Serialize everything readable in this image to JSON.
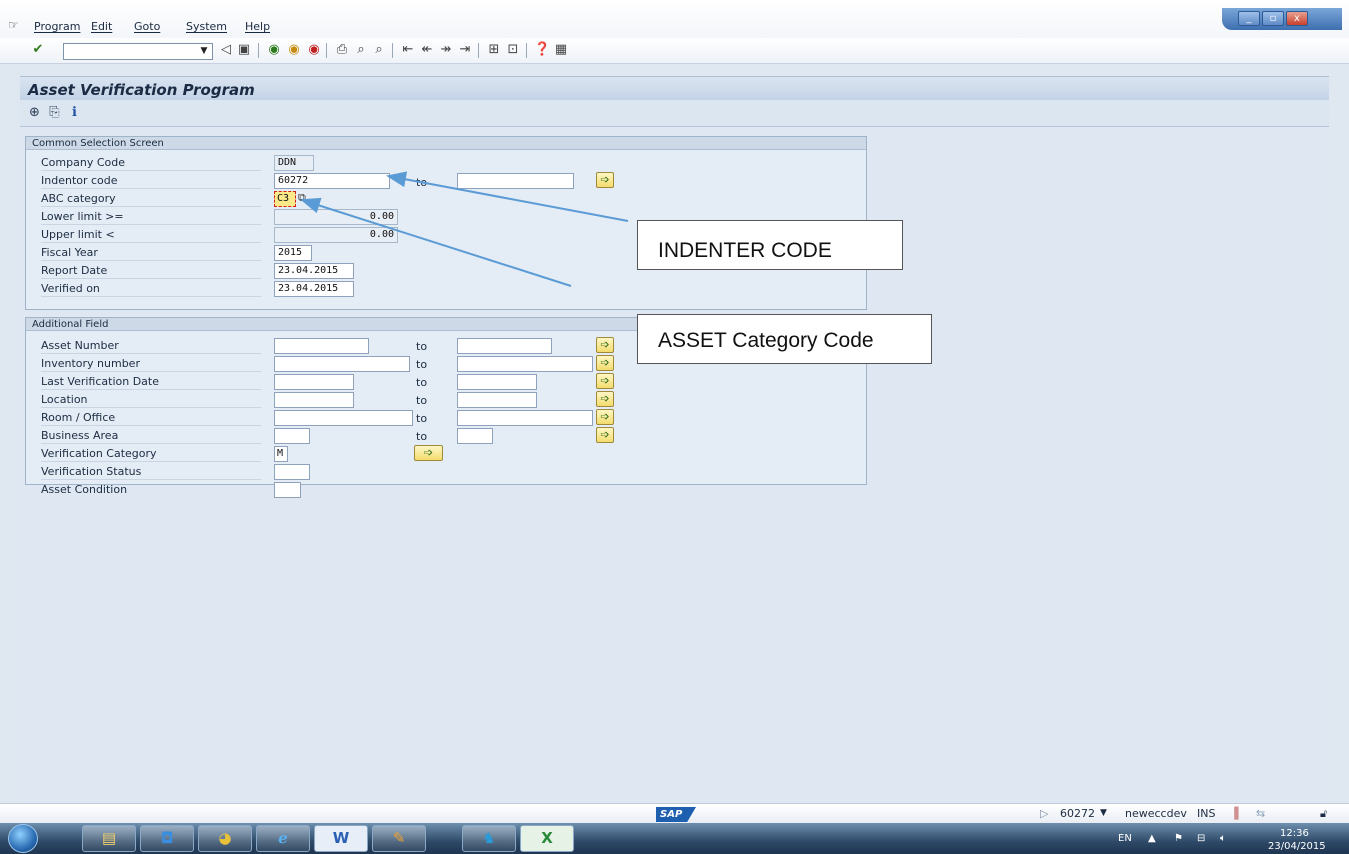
{
  "menu": {
    "items": [
      "Program",
      "Edit",
      "Goto",
      "System",
      "Help"
    ]
  },
  "window_controls": {
    "minimize": "_",
    "restore": "▫",
    "close": "x"
  },
  "toolbar": {
    "command_value": ""
  },
  "title": {
    "text": "Asset Verification Program"
  },
  "common_selection": {
    "heading": "Common Selection Screen",
    "company_code": {
      "label": "Company Code",
      "value": "DDN"
    },
    "indentor_code": {
      "label": "Indentor code",
      "value": "60272",
      "to_label": "to",
      "to_value": ""
    },
    "abc_category": {
      "label": "ABC category",
      "value": "C3"
    },
    "lower_limit": {
      "label": "Lower limit >=",
      "value": "0.00"
    },
    "upper_limit": {
      "label": "Upper limit <",
      "value": "0.00"
    },
    "fiscal_year": {
      "label": "Fiscal Year",
      "value": "2015"
    },
    "report_date": {
      "label": "Report Date",
      "value": "23.04.2015"
    },
    "verified_on": {
      "label": "Verified on",
      "value": "23.04.2015"
    }
  },
  "additional": {
    "heading": "Additional Field",
    "asset_number": {
      "label": "Asset Number",
      "to_label": "to"
    },
    "inventory_number": {
      "label": "Inventory number",
      "to_label": "to"
    },
    "last_verification_date": {
      "label": "Last Verification Date",
      "to_label": "to"
    },
    "location": {
      "label": "Location",
      "to_label": "to"
    },
    "room_office": {
      "label": "Room / Office",
      "to_label": "to"
    },
    "business_area": {
      "label": "Business Area",
      "to_label": "to"
    },
    "verification_category": {
      "label": "Verification Category",
      "value": "M"
    },
    "verification_status": {
      "label": "Verification Status",
      "value": ""
    },
    "asset_condition": {
      "label": "Asset Condition",
      "value": ""
    }
  },
  "callouts": {
    "indenter_code": "INDENTER CODE",
    "asset_category_code": "ASSET Category Code"
  },
  "statusbar": {
    "logo": "SAP",
    "user_code": "60272",
    "server": "neweccdev",
    "mode": "INS"
  },
  "taskbar": {
    "language": "EN",
    "time": "12:36",
    "date": "23/04/2015"
  },
  "colors": {
    "accent": "#1e5fb0",
    "multi_select_button": "#f3dc6e",
    "callout_arrow": "#5b9bd5"
  }
}
